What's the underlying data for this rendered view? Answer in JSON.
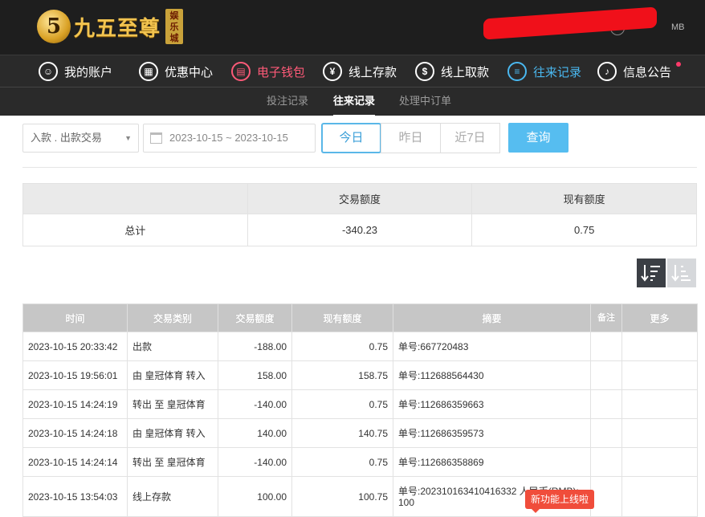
{
  "brand": {
    "name": "九五至尊",
    "badge": [
      "娱",
      "乐",
      "城"
    ],
    "mark": "5",
    "top_right_text": "MB"
  },
  "nav": [
    {
      "label": "我的账户",
      "icon": "user-icon"
    },
    {
      "label": "优惠中心",
      "icon": "gift-icon"
    },
    {
      "label": "电子钱包",
      "icon": "wallet-icon"
    },
    {
      "label": "线上存款",
      "icon": "deposit-icon"
    },
    {
      "label": "线上取款",
      "icon": "withdraw-icon"
    },
    {
      "label": "往来记录",
      "icon": "records-icon"
    },
    {
      "label": "信息公告",
      "icon": "bell-icon"
    }
  ],
  "subnav": [
    "投注记录",
    "往来记录",
    "处理中订单"
  ],
  "filters": {
    "type_value": "入款 . 出款交易",
    "date_range": "2023-10-15 ~ 2023-10-15",
    "ranges": [
      "今日",
      "昨日",
      "近7日"
    ],
    "query_label": "查询"
  },
  "summary": {
    "headers": [
      "",
      "交易额度",
      "现有额度"
    ],
    "row": [
      "总计",
      "-340.23",
      "0.75"
    ]
  },
  "records": {
    "headers": [
      "时间",
      "交易类别",
      "交易额度",
      "现有额度",
      "摘要",
      "备注",
      "更多"
    ],
    "rows": [
      [
        "2023-10-15 20:33:42",
        "出款",
        "-188.00",
        "0.75",
        "单号:667720483",
        "",
        ""
      ],
      [
        "2023-10-15 19:56:01",
        "由 皇冠体育 转入",
        "158.00",
        "158.75",
        "单号:112688564430",
        "",
        ""
      ],
      [
        "2023-10-15 14:24:19",
        "转出 至 皇冠体育",
        "-140.00",
        "0.75",
        "单号:112686359663",
        "",
        ""
      ],
      [
        "2023-10-15 14:24:18",
        "由 皇冠体育 转入",
        "140.00",
        "140.75",
        "单号:112686359573",
        "",
        ""
      ],
      [
        "2023-10-15 14:24:14",
        "转出 至 皇冠体育",
        "-140.00",
        "0.75",
        "单号:112686358869",
        "",
        ""
      ],
      [
        "2023-10-15 13:54:03",
        "线上存款",
        "100.00",
        "100.75",
        "单号:202310163410416332 人民币(RMB): 100",
        "",
        ""
      ]
    ]
  },
  "tooltip": "新功能上线啦",
  "colors": {
    "accent": "#56bdf0",
    "wallet": "#ff5a78",
    "active_nav": "#4ab8f0",
    "header_bg": "#1e1e1e"
  }
}
